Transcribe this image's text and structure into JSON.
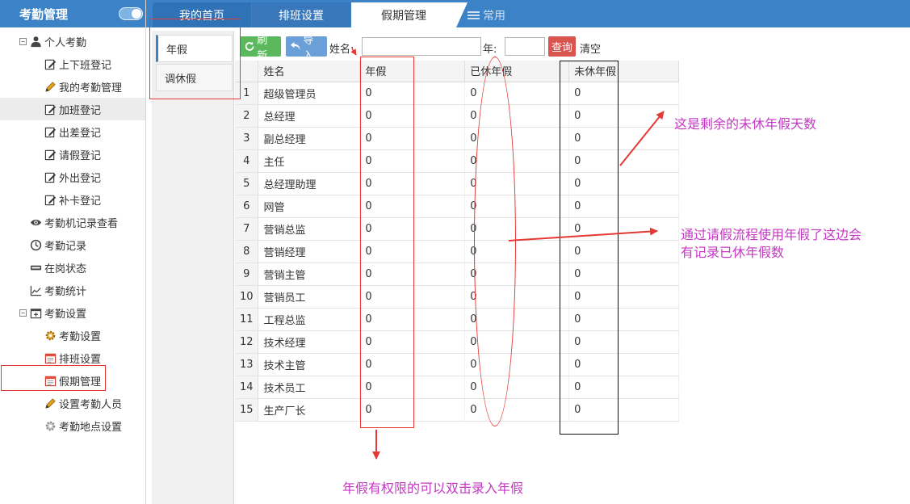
{
  "app": {
    "title": "考勤管理"
  },
  "nav": [
    {
      "label": "个人考勤",
      "level": 0,
      "toggle": "⊟",
      "icon": "user-icon"
    },
    {
      "label": "上下班登记",
      "level": 1,
      "icon": "edit-icon"
    },
    {
      "label": "我的考勤管理",
      "level": 1,
      "icon": "pencil-icon"
    },
    {
      "label": "加班登记",
      "level": 1,
      "icon": "edit-icon",
      "active": true
    },
    {
      "label": "出差登记",
      "level": 1,
      "icon": "edit-icon"
    },
    {
      "label": "请假登记",
      "level": 1,
      "icon": "edit-icon"
    },
    {
      "label": "外出登记",
      "level": 1,
      "icon": "edit-icon"
    },
    {
      "label": "补卡登记",
      "level": 1,
      "icon": "edit-icon"
    },
    {
      "label": "考勤机记录查看",
      "level": 0,
      "icon": "eye-icon"
    },
    {
      "label": "考勤记录",
      "level": 0,
      "icon": "clock-icon"
    },
    {
      "label": "在岗状态",
      "level": 0,
      "icon": "card-icon"
    },
    {
      "label": "考勤统计",
      "level": 0,
      "icon": "line-chart-icon"
    },
    {
      "label": "考勤设置",
      "level": 0,
      "toggle": "⊟",
      "icon": "calendar-plus-icon"
    },
    {
      "label": "考勤设置",
      "level": 1,
      "icon": "gear-icon"
    },
    {
      "label": "排班设置",
      "level": 1,
      "icon": "calendar-icon"
    },
    {
      "label": "假期管理",
      "level": 1,
      "icon": "calendar-icon"
    },
    {
      "label": "设置考勤人员",
      "level": 1,
      "icon": "pencil-icon"
    },
    {
      "label": "考勤地点设置",
      "level": 1,
      "icon": "gear-grey-icon"
    }
  ],
  "tabs": {
    "home": "我的首页",
    "shift": "排班设置",
    "holiday": "假期管理",
    "common": "常用"
  },
  "subtabs": {
    "annual": "年假",
    "comp": "调休假"
  },
  "toolbar": {
    "refresh": "刷新",
    "import": "导入",
    "name_label": "姓名:",
    "name_value": "",
    "year_label": "年:",
    "year_value": "",
    "query": "查询",
    "clear": "清空"
  },
  "table": {
    "headers": [
      "姓名",
      "年假",
      "已休年假",
      "未休年假"
    ],
    "rows": [
      {
        "no": "1",
        "name": "超级管理员",
        "annual": "0",
        "used": "0",
        "remaining": "0"
      },
      {
        "no": "2",
        "name": "总经理",
        "annual": "0",
        "used": "0",
        "remaining": "0"
      },
      {
        "no": "3",
        "name": "副总经理",
        "annual": "0",
        "used": "0",
        "remaining": "0"
      },
      {
        "no": "4",
        "name": "主任",
        "annual": "0",
        "used": "0",
        "remaining": "0"
      },
      {
        "no": "5",
        "name": "总经理助理",
        "annual": "0",
        "used": "0",
        "remaining": "0"
      },
      {
        "no": "6",
        "name": "网管",
        "annual": "0",
        "used": "0",
        "remaining": "0"
      },
      {
        "no": "7",
        "name": "营销总监",
        "annual": "0",
        "used": "0",
        "remaining": "0"
      },
      {
        "no": "8",
        "name": "营销经理",
        "annual": "0",
        "used": "0",
        "remaining": "0"
      },
      {
        "no": "9",
        "name": "营销主管",
        "annual": "0",
        "used": "0",
        "remaining": "0"
      },
      {
        "no": "10",
        "name": "营销员工",
        "annual": "0",
        "used": "0",
        "remaining": "0"
      },
      {
        "no": "11",
        "name": "工程总监",
        "annual": "0",
        "used": "0",
        "remaining": "0"
      },
      {
        "no": "12",
        "name": "技术经理",
        "annual": "0",
        "used": "0",
        "remaining": "0"
      },
      {
        "no": "13",
        "name": "技术主管",
        "annual": "0",
        "used": "0",
        "remaining": "0"
      },
      {
        "no": "14",
        "name": "技术员工",
        "annual": "0",
        "used": "0",
        "remaining": "0"
      },
      {
        "no": "15",
        "name": "生产厂长",
        "annual": "0",
        "used": "0",
        "remaining": "0"
      }
    ]
  },
  "annotations": {
    "remaining_note": "这是剩余的未休年假天数",
    "used_note_line1": "通过请假流程使用年假了这边会",
    "used_note_line2": "有记录已休年假数",
    "annual_note": "年假有权限的可以双击录入年假"
  },
  "colors": {
    "primary": "#3c82c6",
    "refresh": "#5cb85c",
    "import": "#6b9fd8",
    "query": "#d9534f",
    "annotation_red": "#e53935",
    "annotation_text": "#c438c4"
  }
}
